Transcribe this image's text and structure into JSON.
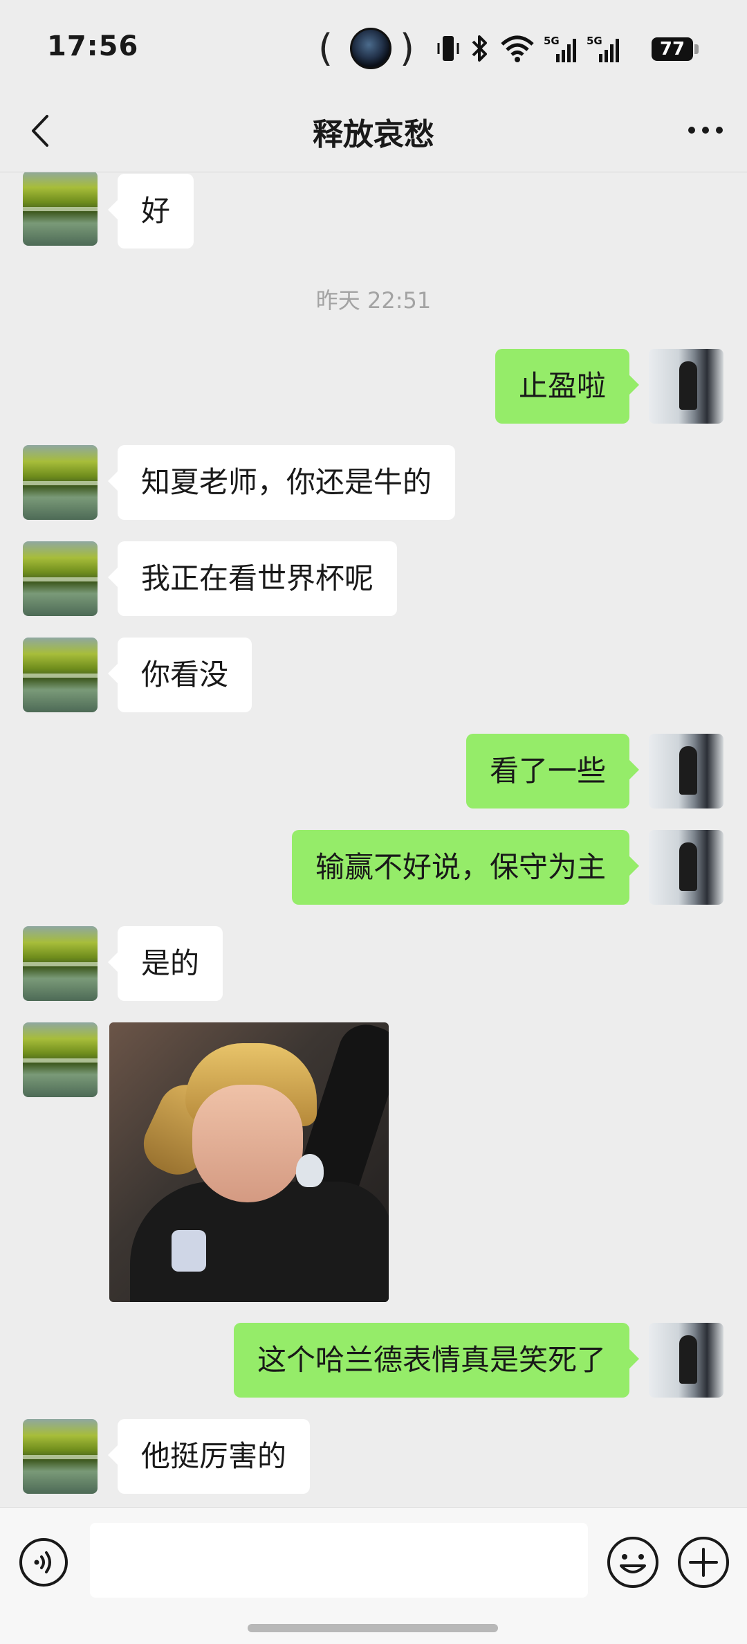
{
  "status_bar": {
    "time": "17:56",
    "battery": "77",
    "network_1": "5G",
    "network_2": "5G"
  },
  "nav": {
    "title": "释放哀愁"
  },
  "messages": [
    {
      "side": "left",
      "text": "好"
    },
    {
      "type": "timestamp",
      "text": "昨天 22:51"
    },
    {
      "side": "right",
      "text": "止盈啦"
    },
    {
      "side": "left",
      "text": "知夏老师，你还是牛的"
    },
    {
      "side": "left",
      "text": "我正在看世界杯呢"
    },
    {
      "side": "left",
      "text": "你看没"
    },
    {
      "side": "right",
      "text": "看了一些"
    },
    {
      "side": "right",
      "text": "输赢不好说，保守为主"
    },
    {
      "side": "left",
      "text": "是的"
    },
    {
      "side": "left",
      "type": "image",
      "icon": "sticker-photo"
    },
    {
      "side": "right",
      "text": "这个哈兰德表情真是笑死了"
    },
    {
      "side": "left",
      "text": "他挺厉害的"
    }
  ],
  "colors": {
    "background": "#ededed",
    "bubble_self": "#95ec69",
    "bubble_other": "#ffffff",
    "timestamp": "#a3a3a3"
  },
  "input_bar": {
    "icons": [
      "voice-icon",
      "emoji-icon",
      "plus-icon"
    ]
  }
}
